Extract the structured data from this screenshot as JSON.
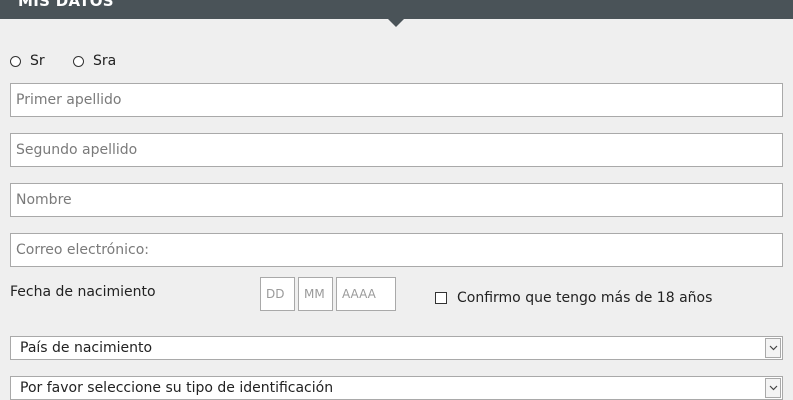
{
  "header": {
    "title": "MIS DATOS"
  },
  "salutation": {
    "options": [
      {
        "label": "Sr"
      },
      {
        "label": "Sra"
      }
    ]
  },
  "fields": {
    "first_surname": {
      "placeholder": "Primer apellido",
      "value": ""
    },
    "second_surname": {
      "placeholder": "Segundo apellido",
      "value": ""
    },
    "name": {
      "placeholder": "Nombre",
      "value": ""
    },
    "email": {
      "placeholder": "Correo electrónico:",
      "value": ""
    }
  },
  "birth_date": {
    "label": "Fecha de nacimiento",
    "day_placeholder": "DD",
    "month_placeholder": "MM",
    "year_placeholder": "AAAA"
  },
  "age_confirm": {
    "label": "Confirmo que tengo más de 18 años",
    "checked": false
  },
  "selects": {
    "birth_country": {
      "selected": "País de nacimiento"
    },
    "id_type": {
      "selected": "Por favor seleccione su tipo de identificación"
    }
  },
  "icons": {
    "dropdown": "chevron-down-icon"
  },
  "colors": {
    "header_bg": "#4a5358",
    "page_bg": "#efefef",
    "border": "#a9a9a9"
  }
}
